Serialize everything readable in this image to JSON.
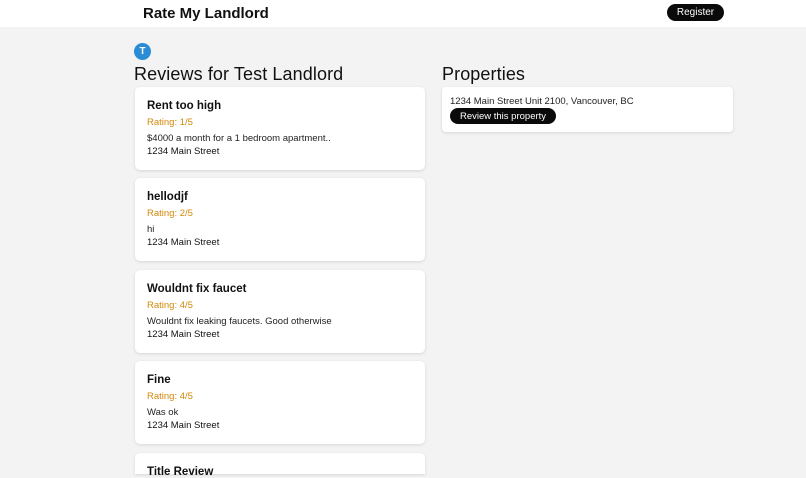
{
  "header": {
    "brand": "Rate My Landlord",
    "register_label": "Register"
  },
  "landlord": {
    "avatar_letter": "T",
    "reviews_heading": "Reviews for Test Landlord"
  },
  "properties_heading": "Properties",
  "reviews": [
    {
      "title": "Rent too high",
      "rating": "Rating: 1/5",
      "body": "$4000 a month for a 1 bedroom apartment..",
      "address": "1234 Main Street"
    },
    {
      "title": "hellodjf",
      "rating": "Rating: 2/5",
      "body": "hi",
      "address": "1234 Main Street"
    },
    {
      "title": "Wouldnt fix faucet",
      "rating": "Rating: 4/5",
      "body": "Wouldnt fix leaking faucets. Good otherwise",
      "address": "1234 Main Street"
    },
    {
      "title": "Fine",
      "rating": "Rating: 4/5",
      "body": "Was ok",
      "address": "1234 Main Street"
    },
    {
      "title": "Title Review"
    }
  ],
  "properties": [
    {
      "address": "1234 Main Street Unit 2100, Vancouver, BC",
      "button_label": "Review this property"
    }
  ]
}
